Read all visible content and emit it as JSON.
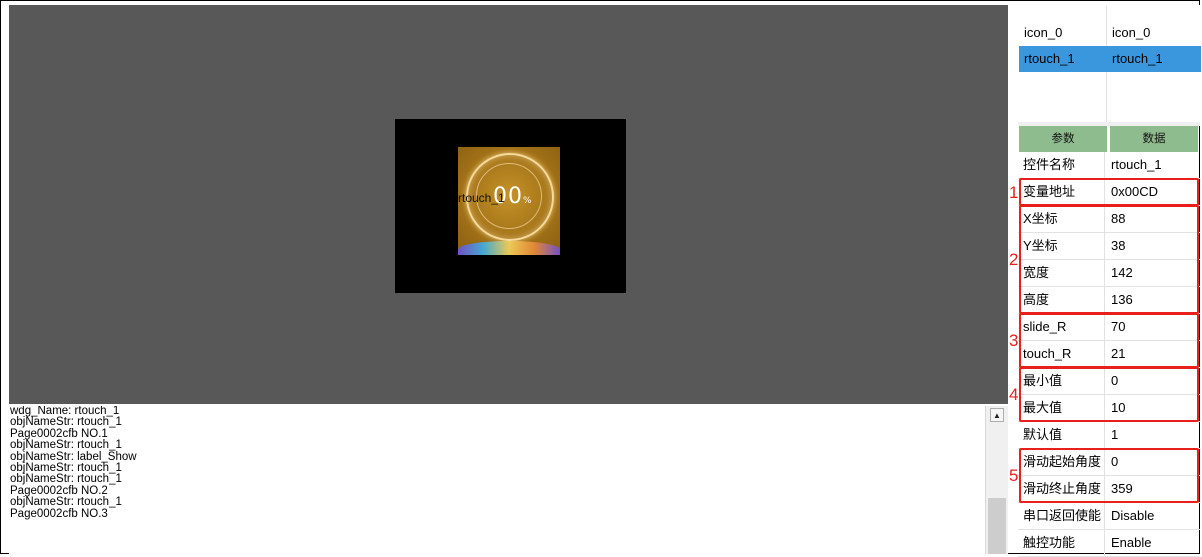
{
  "canvas": {
    "widget_name_label": "rtouch_1",
    "widget_percent": "00",
    "widget_percent_unit": "%"
  },
  "log": {
    "lines": [
      "wdg_Name: rtouch_1",
      "objNameStr: rtouch_1",
      "Page0002cfb NO.1",
      "objNameStr: rtouch_1",
      "objNameStr: label_Show",
      "objNameStr: rtouch_1",
      "objNameStr: rtouch_1",
      "Page0002cfb NO.2",
      "objNameStr: rtouch_1",
      "Page0002cfb NO.3"
    ],
    "scroll_up_glyph": "▲"
  },
  "object_list": {
    "rows": [
      {
        "name": "icon_0",
        "value": "icon_0",
        "selected": false
      },
      {
        "name": "rtouch_1",
        "value": "rtouch_1",
        "selected": true
      }
    ]
  },
  "properties": {
    "header_param": "参数",
    "header_data": "数据",
    "rows": [
      {
        "key": "控件名称",
        "value": "rtouch_1"
      },
      {
        "key": "变量地址",
        "value": "0x00CD"
      },
      {
        "key": "X坐标",
        "value": "88"
      },
      {
        "key": "Y坐标",
        "value": "38"
      },
      {
        "key": "宽度",
        "value": "142"
      },
      {
        "key": "高度",
        "value": "136"
      },
      {
        "key": "slide_R",
        "value": "70"
      },
      {
        "key": "touch_R",
        "value": "21"
      },
      {
        "key": "最小值",
        "value": "0"
      },
      {
        "key": "最大值",
        "value": "10"
      },
      {
        "key": "默认值",
        "value": "1"
      },
      {
        "key": "滑动起始角度",
        "value": "0"
      },
      {
        "key": "滑动终止角度",
        "value": "359"
      },
      {
        "key": "串口返回使能",
        "value": "Disable"
      },
      {
        "key": "触控功能",
        "value": "Enable"
      }
    ]
  },
  "annotations": {
    "numbers": [
      "1",
      "2",
      "3",
      "4",
      "5"
    ],
    "color": "#e8201c"
  },
  "colors": {
    "canvas_bg": "#585858",
    "selection": "#3a96dd",
    "header_bg": "#8fbc8f"
  }
}
